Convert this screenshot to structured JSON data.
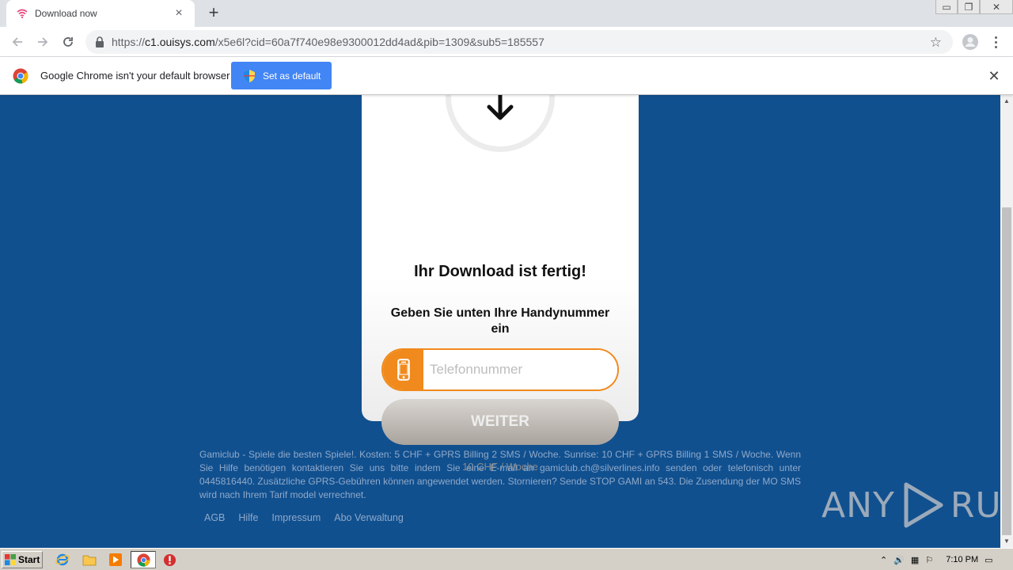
{
  "tab": {
    "title": "Download now",
    "close": "×"
  },
  "new_tab": "+",
  "window": {
    "minimize": "▭",
    "restore": "❐",
    "close": "✕"
  },
  "address_bar": {
    "url_scheme": "https://",
    "url_host": "c1.ouisys.com",
    "url_path": "/x5e6l?cid=60a7f740e98e9300012dd4ad&pib=1309&sub5=185557"
  },
  "infobar": {
    "message": "Google Chrome isn't your default browser",
    "button_label": "Set as default",
    "close": "✕"
  },
  "page": {
    "title": "Ihr Download ist fertig!",
    "subtitle": "Geben Sie unten Ihre Handynummer ein",
    "phone_placeholder": "Telefonnummer",
    "submit_label": "WEITER",
    "price": "10 CHF / Woche",
    "disclaimer": "Gamiclub - Spiele die besten Spiele!. Kosten: 5 CHF + GPRS Billing 2 SMS / Woche. Sunrise: 10 CHF + GPRS Billing 1 SMS / Woche. Wenn Sie Hilfe benötigen kontaktieren Sie uns bitte indem Sie eine E-mail an gamiclub.ch@silverlines.info senden oder telefonisch unter 0445816440. Zusätzliche GPRS-Gebühren können angewendet werden. Stornieren? Sende STOP GAMI an 543. Die Zusendung der MO SMS wird nach Ihrem Tarif model verrechnet.",
    "footer_links": [
      "AGB",
      "Hilfe",
      "Impressum",
      "Abo Verwaltung"
    ]
  },
  "watermark": {
    "left": "ANY",
    "right": "RUN"
  },
  "taskbar": {
    "start_label": "Start",
    "clock": "7:10 PM"
  },
  "colors": {
    "page_bg": "#11508f",
    "accent_orange": "#f08a1c",
    "chrome_blue": "#4285f4"
  }
}
